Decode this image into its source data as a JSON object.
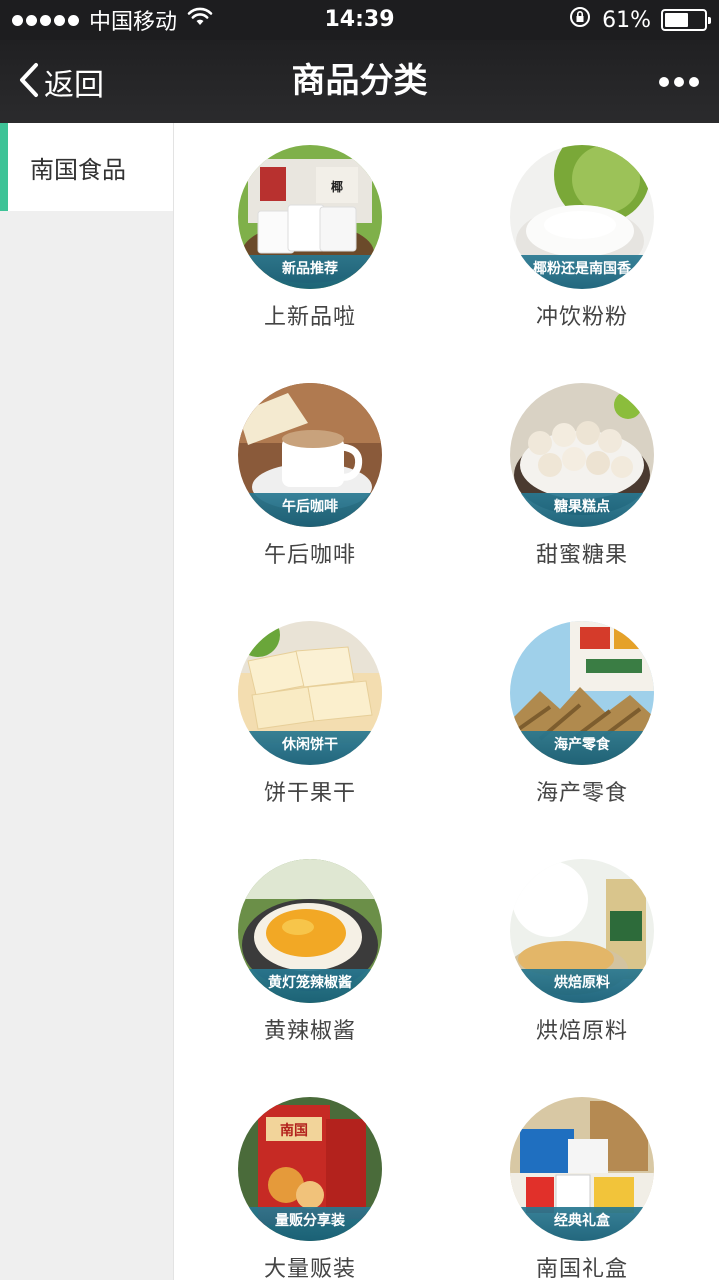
{
  "status_bar": {
    "carrier": "中国移动",
    "time": "14:39",
    "battery_text": "61%",
    "battery_level": 0.61
  },
  "nav": {
    "back_label": "返回",
    "title": "商品分类"
  },
  "sidebar": {
    "items": [
      {
        "label": "南国食品",
        "selected": true
      }
    ]
  },
  "categories": [
    {
      "label": "上新品啦",
      "banner": "新品推荐",
      "image": "new-products-image"
    },
    {
      "label": "冲饮粉粉",
      "banner": "椰粉还是南国香",
      "image": "coconut-powder-image"
    },
    {
      "label": "午后咖啡",
      "banner": "午后咖啡",
      "image": "coffee-cup-image"
    },
    {
      "label": "甜蜜糖果",
      "banner": "糖果糕点",
      "image": "coconut-candy-image"
    },
    {
      "label": "饼干果干",
      "banner": "休闲饼干",
      "image": "wafer-biscuits-image"
    },
    {
      "label": "海产零食",
      "banner": "海产零食",
      "image": "dried-seafood-image"
    },
    {
      "label": "黄辣椒酱",
      "banner": "黄灯笼辣椒酱",
      "image": "chili-sauce-image"
    },
    {
      "label": "烘焙原料",
      "banner": "烘焙原料",
      "image": "baking-ingredients-image"
    },
    {
      "label": "大量贩装",
      "banner": "量贩分享装",
      "image": "bulk-coffee-box-image"
    },
    {
      "label": "南国礼盒",
      "banner": "经典礼盒",
      "image": "gift-box-image"
    }
  ]
}
